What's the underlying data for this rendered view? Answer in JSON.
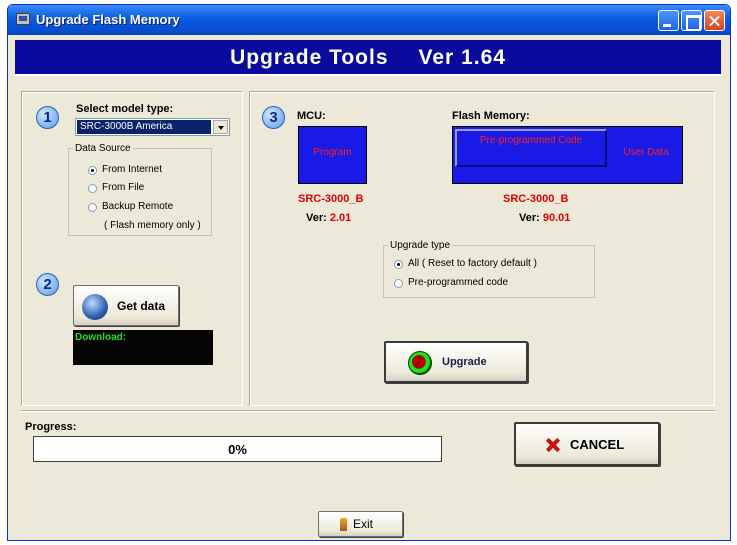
{
  "window": {
    "title": "Upgrade  Flash Memory"
  },
  "banner": {
    "title": "Upgrade Tools",
    "version": "Ver 1.64"
  },
  "step1": {
    "number": "1",
    "label": "Select model type:",
    "model_select_value": "SRC-3000B America",
    "data_source": {
      "legend": "Data Source",
      "options": [
        {
          "label": "From Internet",
          "selected": true
        },
        {
          "label": "From File",
          "selected": false
        },
        {
          "label": "Backup Remote",
          "selected": false
        }
      ],
      "note": "( Flash memory only )"
    }
  },
  "step2": {
    "number": "2",
    "get_data_label": "Get data",
    "download_status": "Download:"
  },
  "step3": {
    "number": "3",
    "mcu": {
      "label": "MCU:",
      "program_label": "Program",
      "model": "SRC-3000_B",
      "ver_label": "Ver:",
      "version": "2.01"
    },
    "flash": {
      "label": "Flash Memory:",
      "preprogrammed_label": "Pre-programmed Code",
      "user_data_label": "User Data",
      "model": "SRC-3000_B",
      "ver_label": "Ver:",
      "version": "90.01"
    },
    "upgrade_type": {
      "legend": "Upgrade type",
      "options": [
        {
          "label": "All ( Reset to factory default )",
          "selected": true
        },
        {
          "label": "Pre-programmed code",
          "selected": false
        }
      ]
    },
    "upgrade_label": "Upgrade"
  },
  "progress": {
    "label": "Progress:",
    "value_text": "0%",
    "fraction": 0.0
  },
  "cancel_label": "CANCEL",
  "exit_label": "Exit",
  "colors": {
    "banner_bg": "#0a0a9c",
    "blue_box": "#1a1ae6",
    "red_text": "#e00000",
    "download_text": "#22dd22"
  }
}
